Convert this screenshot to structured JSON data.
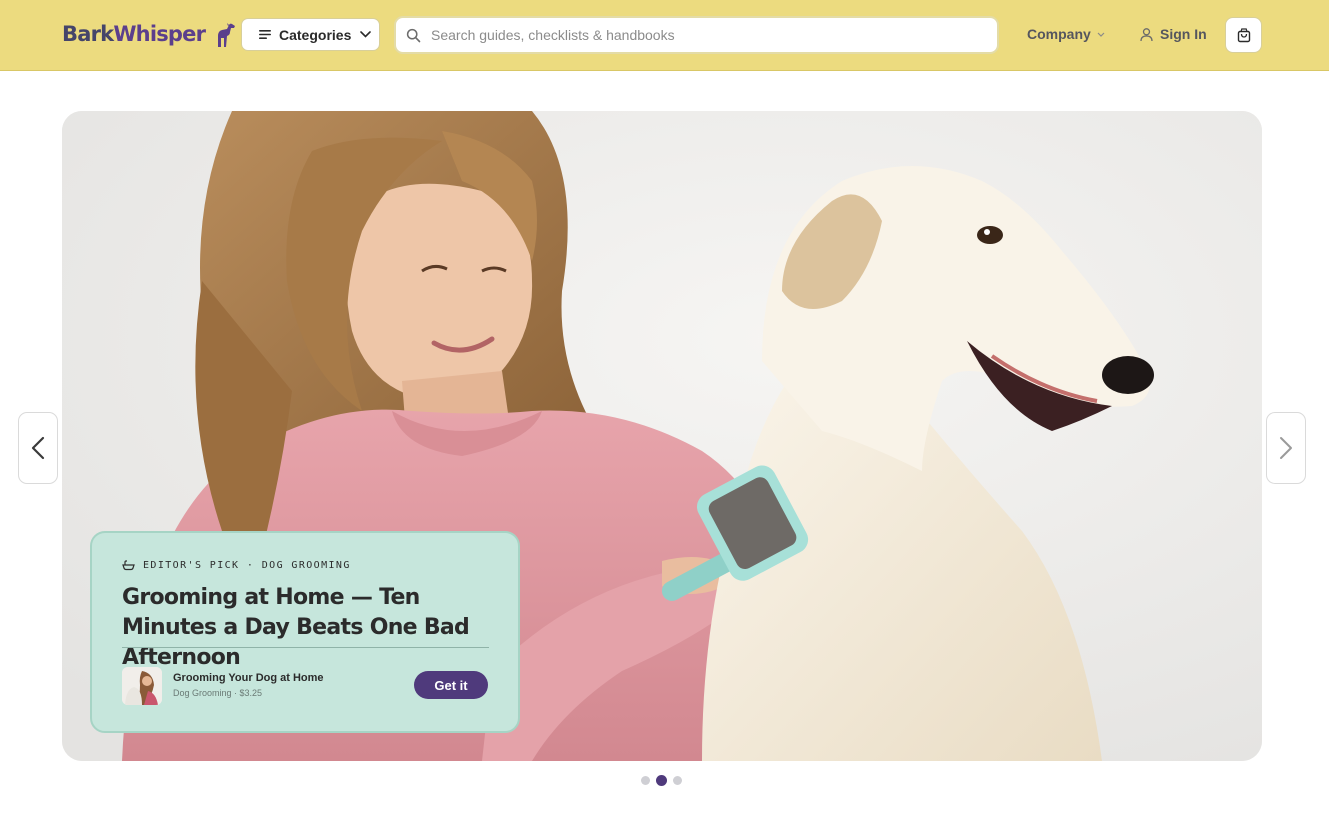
{
  "brand": {
    "name_part1": "Bark",
    "name_part2": "Whisper",
    "logo_icon": "greyhound-logo-icon",
    "colors": {
      "header_bg": "#ecdb7f",
      "accent": "#4f3a7c",
      "card_bg": "#c6e6dc"
    }
  },
  "header": {
    "categories_label": "Categories",
    "search_placeholder": "Search guides, checklists & handbooks",
    "search_value": "",
    "company_label": "Company",
    "signin_label": "Sign In"
  },
  "hero": {
    "image_alt": "",
    "eyebrow": "EDITOR'S PICK · DOG GROOMING",
    "title": "Grooming at Home — Ten Minutes a Day Beats One Bad Afternoon",
    "product": {
      "title": "Grooming Your Dog at Home",
      "meta": "Dog Grooming · $3.25",
      "cta": "Get it"
    }
  },
  "carousel": {
    "slides": 3,
    "active_slide": 2,
    "icons": [
      "chevron-left-icon",
      "chevron-right-icon"
    ]
  }
}
